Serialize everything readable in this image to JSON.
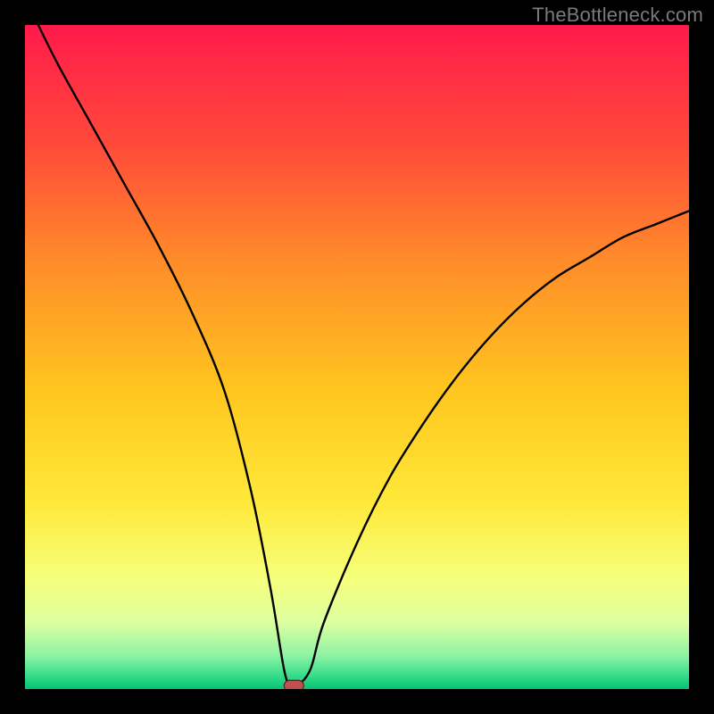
{
  "watermark": "TheBottleneck.com",
  "chart_data": {
    "type": "line",
    "title": "",
    "xlabel": "",
    "ylabel": "",
    "xlim": [
      0,
      100
    ],
    "ylim": [
      0,
      100
    ],
    "grid": false,
    "legend": false,
    "notes": "Bottleneck chart. Background is a vertical spectrum from red (top, high bottleneck) through orange/yellow to green (bottom, optimal). A black curve descends from upper-left to a minimum near x≈40 then rises to the right; a small red rounded marker indicates the minimum (optimal point). No visible axis ticks or numeric labels in the source image, so values are approximate.",
    "series": [
      {
        "name": "bottleneck-curve",
        "x": [
          2,
          5,
          10,
          15,
          20,
          25,
          30,
          34,
          37,
          39,
          40,
          41,
          43,
          45,
          50,
          55,
          60,
          65,
          70,
          75,
          80,
          85,
          90,
          95,
          100
        ],
        "y": [
          100,
          94,
          85,
          76,
          67,
          57,
          45,
          30,
          15,
          3,
          0.5,
          0.5,
          3,
          10,
          22,
          32,
          40,
          47,
          53,
          58,
          62,
          65,
          68,
          70,
          72
        ]
      }
    ],
    "marker": {
      "x": 40.5,
      "y": 0.5
    },
    "colors": {
      "gradient": [
        "#ff1a4b",
        "#ff6a2e",
        "#ffb122",
        "#ffe423",
        "#f7ff6e",
        "#c7ff8f",
        "#37e98e",
        "#08c977"
      ],
      "curve": "#000000",
      "marker_fill": "#c05050",
      "marker_stroke": "#5a1f1f"
    }
  }
}
